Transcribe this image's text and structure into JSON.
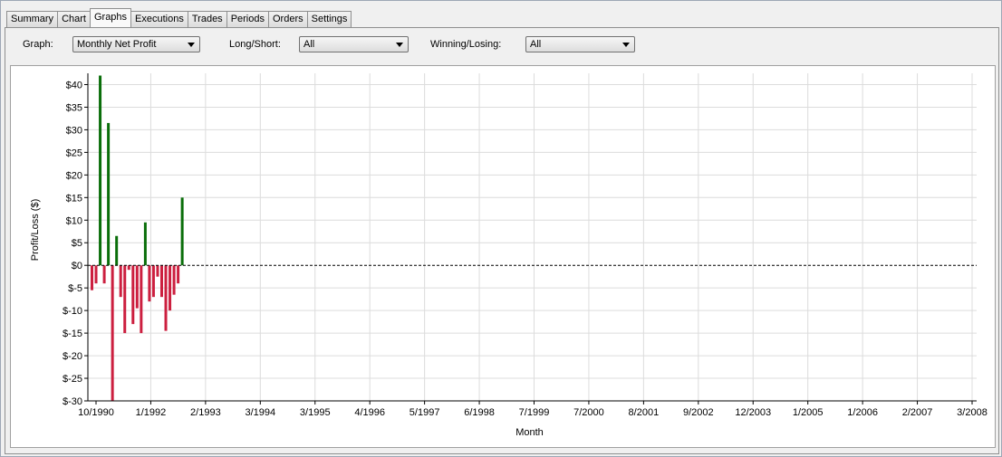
{
  "tabs": [
    {
      "label": "Summary",
      "active": false
    },
    {
      "label": "Chart",
      "active": false
    },
    {
      "label": "Graphs",
      "active": true
    },
    {
      "label": "Executions",
      "active": false
    },
    {
      "label": "Trades",
      "active": false
    },
    {
      "label": "Periods",
      "active": false
    },
    {
      "label": "Orders",
      "active": false
    },
    {
      "label": "Settings",
      "active": false
    }
  ],
  "toolbar": {
    "graph_label": "Graph:",
    "graph_value": "Monthly Net Profit",
    "longshort_label": "Long/Short:",
    "longshort_value": "All",
    "winlose_label": "Winning/Losing:",
    "winlose_value": "All"
  },
  "colors": {
    "positive": "#0a6e0a",
    "negative": "#cc1f3f",
    "grid": "#dcdcdc"
  },
  "chart_data": {
    "type": "bar",
    "xlabel": "Month",
    "ylabel": "Profit/Loss ($)",
    "ylim": [
      -30,
      42.5
    ],
    "yticks": [
      40,
      35,
      30,
      25,
      20,
      15,
      10,
      5,
      0,
      -5,
      -10,
      -15,
      -20,
      -25,
      -30
    ],
    "ytick_labels": [
      "$40",
      "$35",
      "$30",
      "$25",
      "$20",
      "$15",
      "$10",
      "$5",
      "$0",
      "$-5",
      "$-10",
      "$-15",
      "$-20",
      "$-25",
      "$-30"
    ],
    "x_tick_labels": [
      "10/1990",
      "1/1992",
      "2/1993",
      "3/1994",
      "3/1995",
      "4/1996",
      "5/1997",
      "6/1998",
      "7/1999",
      "7/2000",
      "8/2001",
      "9/2002",
      "12/2003",
      "1/2005",
      "1/2006",
      "2/2007",
      "3/2008"
    ],
    "total_months": 220,
    "grid": true,
    "zero_line": "dashed",
    "categories": [
      "10/1990",
      "11/1990",
      "12/1990",
      "1/1991",
      "2/1991",
      "3/1991",
      "4/1991",
      "5/1991",
      "6/1991",
      "7/1991",
      "8/1991",
      "9/1991",
      "10/1991",
      "11/1991",
      "12/1991",
      "1/1992",
      "2/1992",
      "3/1992",
      "4/1992",
      "5/1992",
      "6/1992",
      "7/1992",
      "8/1992"
    ],
    "values": [
      -5.5,
      -4,
      42,
      -4,
      31.5,
      -30,
      6.5,
      -7,
      -15,
      -1,
      -13,
      -9.5,
      -15,
      9.5,
      -8,
      -7,
      -2.5,
      -7,
      -14.5,
      -10,
      -6.5,
      -4,
      15
    ]
  }
}
